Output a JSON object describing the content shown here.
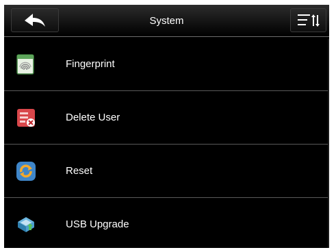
{
  "header": {
    "title": "System",
    "back_icon": "back-arrow-icon",
    "sort_icon": "sort-menu-icon"
  },
  "menu": {
    "items": [
      {
        "label": "Fingerprint",
        "icon": "fingerprint-icon"
      },
      {
        "label": "Delete User",
        "icon": "delete-user-icon"
      },
      {
        "label": "Reset",
        "icon": "reset-icon"
      },
      {
        "label": "USB Upgrade",
        "icon": "usb-upgrade-icon"
      }
    ]
  },
  "colors": {
    "background": "#000000",
    "text": "#ffffff",
    "divider": "#5a5a5a"
  }
}
